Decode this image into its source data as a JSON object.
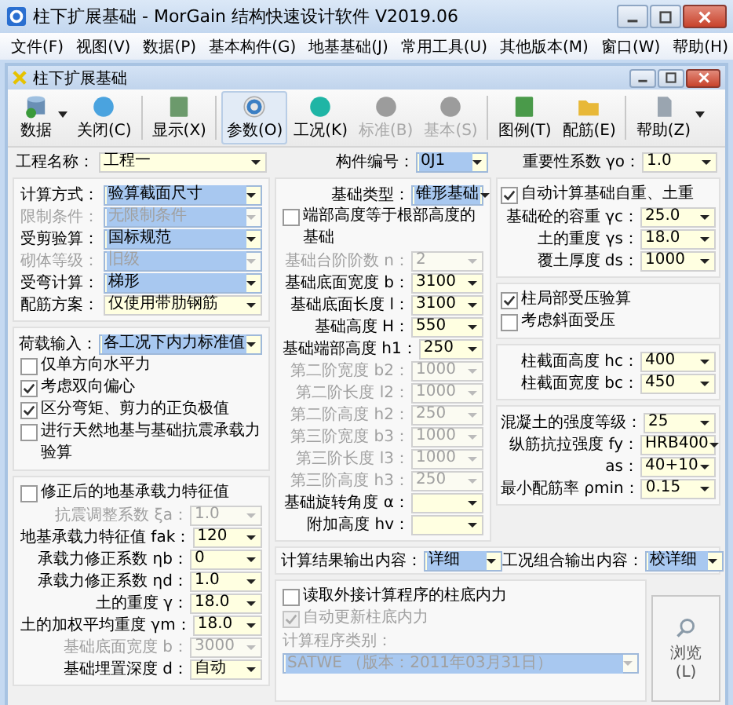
{
  "window": {
    "title": "柱下扩展基础 - MorGain 结构快速设计软件 V2019.06"
  },
  "menu": [
    "文件(F)",
    "视图(V)",
    "数据(P)",
    "基本构件(G)",
    "地基基础(J)",
    "常用工具(U)",
    "其他版本(M)",
    "窗口(W)",
    "帮助(H)"
  ],
  "child_window": {
    "title": "柱下扩展基础"
  },
  "toolbar": [
    {
      "label": "数据",
      "selected": false,
      "disabled": false,
      "has_menu": true
    },
    {
      "label": "关闭(C)",
      "selected": false,
      "disabled": false,
      "has_menu": false
    },
    {
      "label": "显示(X)",
      "selected": false,
      "disabled": false,
      "has_menu": false
    },
    {
      "label": "参数(O)",
      "selected": true,
      "disabled": false,
      "has_menu": false
    },
    {
      "label": "工况(K)",
      "selected": false,
      "disabled": false,
      "has_menu": false
    },
    {
      "label": "标准(B)",
      "selected": false,
      "disabled": true,
      "has_menu": false
    },
    {
      "label": "基本(S)",
      "selected": false,
      "disabled": true,
      "has_menu": false
    },
    {
      "label": "图例(T)",
      "selected": false,
      "disabled": false,
      "has_menu": false
    },
    {
      "label": "配筋(E)",
      "selected": false,
      "disabled": false,
      "has_menu": false
    },
    {
      "label": "帮助(Z)",
      "selected": false,
      "disabled": false,
      "has_menu": true
    }
  ],
  "top_row": [
    {
      "kind": "field",
      "label": "工程名称：",
      "value": "工程一",
      "highlighted": false,
      "disabled": false
    },
    {
      "kind": "field",
      "label": "构件编号：",
      "value": "0J1",
      "highlighted": true,
      "disabled": false
    },
    {
      "kind": "field",
      "label": "重要性系数 γo：",
      "value": "1.0",
      "highlighted": false,
      "disabled": false
    }
  ],
  "columns": {
    "left": [
      {
        "items": [
          {
            "kind": "field",
            "label": "计算方式：",
            "value": "验算截面尺寸",
            "highlighted": true,
            "disabled": false
          },
          {
            "kind": "field",
            "label": "限制条件：",
            "value": "无限制条件",
            "highlighted": true,
            "disabled": true
          },
          {
            "kind": "field",
            "label": "受剪验算：",
            "value": "国标规范",
            "highlighted": true,
            "disabled": false
          },
          {
            "kind": "field",
            "label": "砌体等级：",
            "value": "旧级",
            "highlighted": true,
            "disabled": true
          },
          {
            "kind": "field",
            "label": "受弯计算：",
            "value": "梯形",
            "highlighted": true,
            "disabled": false
          },
          {
            "kind": "field",
            "label": "配筋方案：",
            "value": "仅使用带肋钢筋",
            "highlighted": false,
            "disabled": false
          }
        ]
      },
      {
        "items": [
          {
            "kind": "field",
            "label": "荷载输入：",
            "value": "各工况下内力标准值",
            "highlighted": true,
            "disabled": false
          },
          {
            "kind": "checkbox",
            "label": "仅单方向水平力",
            "checked": false,
            "disabled": false
          },
          {
            "kind": "checkbox",
            "label": "考虑双向偏心",
            "checked": true,
            "disabled": false
          },
          {
            "kind": "checkbox",
            "label": "区分弯矩、剪力的正负极值",
            "checked": true,
            "disabled": false
          },
          {
            "kind": "checkbox",
            "label": "进行天然地基与基础抗震承载力验算",
            "checked": false,
            "disabled": false
          }
        ]
      },
      {
        "items": [
          {
            "kind": "checkbox",
            "label": "修正后的地基承载力特征值",
            "checked": false,
            "disabled": false
          },
          {
            "kind": "field",
            "label": "抗震调整系数 ξa：",
            "value": "1.0",
            "highlighted": false,
            "disabled": true
          },
          {
            "kind": "field",
            "label": "地基承载力特征值 fak：",
            "value": "120",
            "highlighted": false,
            "disabled": false
          },
          {
            "kind": "field",
            "label": "承载力修正系数 ηb：",
            "value": "0",
            "highlighted": false,
            "disabled": false
          },
          {
            "kind": "field",
            "label": "承载力修正系数 ηd：",
            "value": "1.0",
            "highlighted": false,
            "disabled": false
          },
          {
            "kind": "field",
            "label": "土的重度 γ：",
            "value": "18.0",
            "highlighted": false,
            "disabled": false
          },
          {
            "kind": "field",
            "label": "土的加权平均重度 γm：",
            "value": "18.0",
            "highlighted": false,
            "disabled": false
          },
          {
            "kind": "field",
            "label": "基础底面宽度 b：",
            "value": "3000",
            "highlighted": false,
            "disabled": true
          },
          {
            "kind": "field",
            "label": "基础埋置深度 d：",
            "value": "自动",
            "highlighted": false,
            "disabled": false
          }
        ]
      }
    ],
    "middle": [
      {
        "items": [
          {
            "kind": "field",
            "label": "基础类型：",
            "value": "锥形基础",
            "highlighted": true,
            "disabled": false
          },
          {
            "kind": "checkbox",
            "label": "端部高度等于根部高度的基础",
            "checked": false,
            "disabled": false
          },
          {
            "kind": "field",
            "label": "基础台阶阶数 n：",
            "value": "2",
            "highlighted": false,
            "disabled": true
          },
          {
            "kind": "field",
            "label": "基础底面宽度 b：",
            "value": "3100",
            "highlighted": false,
            "disabled": false
          },
          {
            "kind": "field",
            "label": "基础底面长度 l：",
            "value": "3100",
            "highlighted": false,
            "disabled": false
          },
          {
            "kind": "field",
            "label": "基础高度 H：",
            "value": "550",
            "highlighted": false,
            "disabled": false
          },
          {
            "kind": "field",
            "label": "基础端部高度 h1：",
            "value": "250",
            "highlighted": false,
            "disabled": false
          },
          {
            "kind": "field",
            "label": "第二阶宽度 b2：",
            "value": "1000",
            "highlighted": false,
            "disabled": true
          },
          {
            "kind": "field",
            "label": "第二阶长度 l2：",
            "value": "1000",
            "highlighted": false,
            "disabled": true
          },
          {
            "kind": "field",
            "label": "第二阶高度 h2：",
            "value": "250",
            "highlighted": false,
            "disabled": true
          },
          {
            "kind": "field",
            "label": "第三阶宽度 b3：",
            "value": "1000",
            "highlighted": false,
            "disabled": true
          },
          {
            "kind": "field",
            "label": "第三阶长度 l3：",
            "value": "1000",
            "highlighted": false,
            "disabled": true
          },
          {
            "kind": "field",
            "label": "第三阶高度 h3：",
            "value": "250",
            "highlighted": false,
            "disabled": true
          },
          {
            "kind": "field",
            "label": "基础旋转角度 α：",
            "highlighted": false,
            "disabled": false
          },
          {
            "kind": "field",
            "label": "附加高度 hv：",
            "highlighted": false,
            "disabled": false
          }
        ]
      }
    ],
    "right": [
      {
        "items": [
          {
            "kind": "checkbox",
            "label": "自动计算基础自重、土重",
            "checked": true,
            "disabled": false
          },
          {
            "kind": "field",
            "label": "基础砼的容重 γc：",
            "value": "25.0",
            "highlighted": false,
            "disabled": false
          },
          {
            "kind": "field",
            "label": "土的重度 γs：",
            "value": "18.0",
            "highlighted": false,
            "disabled": false
          },
          {
            "kind": "field",
            "label": "覆土厚度 ds：",
            "value": "1000",
            "highlighted": false,
            "disabled": false
          }
        ]
      },
      {
        "items": [
          {
            "kind": "checkbox",
            "label": "柱局部受压验算",
            "checked": true,
            "disabled": false
          },
          {
            "kind": "checkbox",
            "label": "考虑斜面受压",
            "checked": false,
            "disabled": false
          }
        ]
      },
      {
        "items": [
          {
            "kind": "field",
            "label": "柱截面高度 hc：",
            "value": "400",
            "highlighted": false,
            "disabled": false
          },
          {
            "kind": "field",
            "label": "柱截面宽度 bc：",
            "value": "450",
            "highlighted": false,
            "disabled": false
          }
        ]
      },
      {
        "items": [
          {
            "kind": "field",
            "label": "混凝土的强度等级：",
            "value": "25",
            "highlighted": false,
            "disabled": false
          },
          {
            "kind": "field",
            "label": "纵筋抗拉强度 fy：",
            "value": "HRB400",
            "highlighted": false,
            "disabled": false
          },
          {
            "kind": "field",
            "label": "as：",
            "value": "40+10",
            "highlighted": false,
            "disabled": false
          },
          {
            "kind": "field",
            "label": "最小配筋率 ρmin：",
            "value": "0.15",
            "highlighted": false,
            "disabled": false
          }
        ]
      }
    ]
  },
  "output_row": [
    {
      "kind": "field",
      "label": "计算结果输出内容：",
      "value": "详细",
      "highlighted": true,
      "disabled": false
    },
    {
      "kind": "field",
      "label": "工况组合输出内容：",
      "value": "校详细",
      "highlighted": true,
      "disabled": false
    }
  ],
  "bottom_group": {
    "items": [
      {
        "kind": "checkbox",
        "label": "读取外接计算程序的柱底内力",
        "checked": false,
        "disabled": false
      },
      {
        "kind": "checkbox",
        "label": "自动更新柱底内力",
        "checked": true,
        "disabled": true
      },
      {
        "kind": "field",
        "label": "计算程序类别：",
        "value": "SATWE （版本：2011年03月31日）",
        "highlighted": true,
        "disabled": true
      }
    ],
    "browse_button": "浏览(L)"
  }
}
